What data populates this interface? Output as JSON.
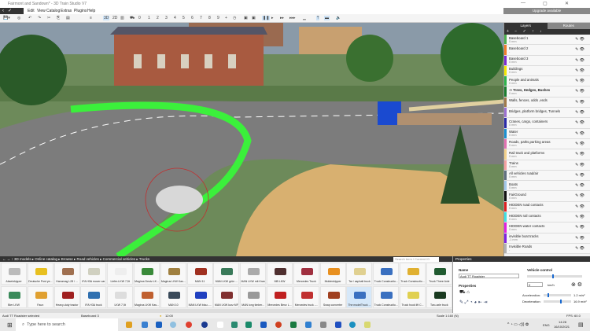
{
  "window": {
    "title": "Fairmont and Sandown* - 3D Train Studio V7",
    "min": "—",
    "max": "▢",
    "close": "✕"
  },
  "menu": [
    "Edit",
    "View",
    "Catalog",
    "Extras",
    "Plugins",
    "Help"
  ],
  "upgrade": "Upgrade available",
  "toolbar": {
    "view3d": "3D",
    "view2d": "2D",
    "numbers": [
      "0",
      "1",
      "2",
      "3",
      "4",
      "5",
      "6",
      "7",
      "8",
      "9",
      "+"
    ]
  },
  "layers_panel": {
    "tabs": [
      "Layers",
      "Routes"
    ],
    "tools": "+ − ✓ ↑ ↓",
    "items": [
      {
        "name": "Baseboard 1",
        "sub": "0 mm",
        "color": "#4caf50"
      },
      {
        "name": "Baseboard 2",
        "sub": "-",
        "color": "#f07b2a"
      },
      {
        "name": "Baseboard 3",
        "sub": "0 mm",
        "color": "#7b2bd1"
      },
      {
        "name": "Buildings",
        "sub": "0 mm",
        "color": "#f2e600"
      },
      {
        "name": "People and animals",
        "sub": "0 mm",
        "color": "#2db34a"
      },
      {
        "name": "-> Trees, Hedges, Bushes",
        "sub": "0 mm",
        "color": "#1b7d2e",
        "bold": true
      },
      {
        "name": "Walls, fences, odds ,ends",
        "sub": "-",
        "color": "#a07a4a"
      },
      {
        "name": "Bridges, platform bridges, Tunnels",
        "sub": "-",
        "color": "#9b6fd0"
      },
      {
        "name": "Cranes, cargo, containers",
        "sub": "0 mm",
        "color": "#2a2aa8"
      },
      {
        "name": "Water",
        "sub": "0 mm",
        "color": "#1a8fd0"
      },
      {
        "name": "Roads, paths,parking areas",
        "sub": "0 mm",
        "color": "#e070b0"
      },
      {
        "name": "Rail track and platforms",
        "sub": "0 mm",
        "color": "#f2d08a"
      },
      {
        "name": "Trains",
        "sub": "0 mm",
        "color": "#f4a0a0"
      },
      {
        "name": "All vehicles road/air",
        "sub": "0 mm",
        "color": "#607080"
      },
      {
        "name": "Boats",
        "sub": "0 mm",
        "color": "#a0c8e8"
      },
      {
        "name": "FairGround",
        "sub": "0 mm",
        "color": "#111111"
      },
      {
        "name": "HIDDEN road contacts",
        "sub": "0 mm",
        "color": "#e02020"
      },
      {
        "name": "HIDDEN rail contacts",
        "sub": "0 mm",
        "color": "#40e0e0"
      },
      {
        "name": "HIDDEN water contacts",
        "sub": "0 mm",
        "color": "#e020e0"
      },
      {
        "name": "invisible boat tracks",
        "sub": "-1 mm",
        "color": "#8020e0"
      },
      {
        "name": "Invisible Roads",
        "sub": "-",
        "color": "#b0b0b0"
      }
    ]
  },
  "catalog": {
    "breadcrumb": "← → ↑  3D models ▸ Online catalog ▸ Browse ▸ Road vehicles ▸ Commercial vehicles ▸ Trucks",
    "search_placeholder": "Search term / Content ID",
    "row1": [
      "Absetzkipper",
      "Deutsche Post ye...",
      "Hanomag L28 / ...",
      "IFA H3A mover car",
      "Liefer-LKW 7,5t",
      "Magirus Deutz LK...",
      "Magirus LKW Kas...",
      "MAN 11",
      "MAN LKW grün ...",
      "MAN LKW mit Kran",
      "MB LKW",
      "Mercedes Truck",
      "Muldenkipper",
      "Tar / asphalt truck",
      "Truck Constructio...",
      "Truck Constructio...",
      "Truck Three Axle"
    ],
    "row2": [
      "Bier LKW",
      "Faun",
      "Heavy-duty tractor",
      "IFA H3A truck",
      "LKW 7,5t",
      "Magirus LKW Kas...",
      "MAN 10",
      "MAN LKW blau -...",
      "MAN LKW kurz MF",
      "MAN long timber...",
      "Mercedes Benz L...",
      "Mercedes truck -...",
      "Swap converter",
      "The modelTruck ...",
      "Truck Constructio...",
      "Truck hook lift C...",
      "Two-axle truck"
    ],
    "colors1": [
      "#bbb",
      "#e8c020",
      "#a07050",
      "#d0d0c0",
      "#eee",
      "#3a8a3a",
      "#a08040",
      "#a03020",
      "#3a7a5a",
      "#aaa",
      "#503030",
      "#a03040",
      "#e89020",
      "#e0d090",
      "#3a70c0",
      "#e0b030",
      "#205a30"
    ],
    "colors2": [
      "#3a8a5a",
      "#e0a030",
      "#a02020",
      "#3070b0",
      "#ddd",
      "#c06030",
      "#3a4a5a",
      "#2040c0",
      "#803030",
      "#999",
      "#c02020",
      "#c03030",
      "#a04020",
      "#3a70c0",
      "#3a70c0",
      "#e0d050",
      "#1a3a20"
    ]
  },
  "properties": {
    "header": "Properties",
    "name_label": "Name",
    "name_value": "Audi TT Roadster",
    "props_label": "Properties",
    "vehicle_control": "Vehicle control",
    "speed": "0",
    "speed_unit": "km/h",
    "accel_label": "Acceleration:",
    "accel_value": "1.2 m/s²",
    "decel_label": "Deceleration:",
    "decel_value": "16.9 m/s²",
    "speed_fraction": 0.45,
    "accel_fraction": 0.15,
    "decel_fraction": 0.6
  },
  "status": {
    "selected": "Audi TT Roadster selected",
    "layer": "Baseboard 3",
    "time": "12:00",
    "scale": "Scale 1:160 (N)",
    "fps": "FPS: 60.0"
  },
  "taskbar": {
    "search": "Type here to search",
    "lang": "ENG",
    "clock": "14:28",
    "date": "16/10/2021"
  }
}
